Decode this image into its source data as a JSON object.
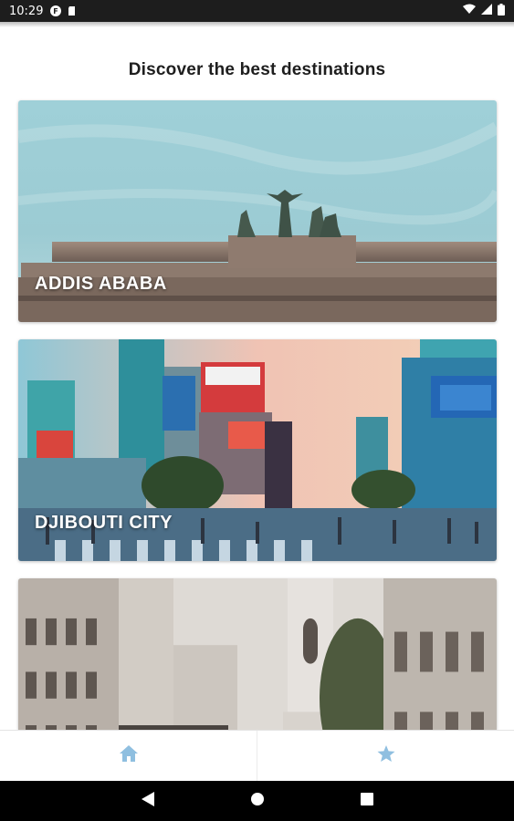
{
  "status_bar": {
    "time": "10:29",
    "icons": [
      "notification-f-icon",
      "sd-card-icon",
      "wifi-icon",
      "signal-icon",
      "battery-icon"
    ]
  },
  "page": {
    "title": "Discover the best destinations"
  },
  "destinations": [
    {
      "name": "ADDIS ABABA",
      "image": "landmark-gate-with-statues"
    },
    {
      "name": "DJIBOUTI CITY",
      "image": "busy-city-crossing-billboards"
    },
    {
      "name": "",
      "image": "historic-buildings-street"
    }
  ],
  "bottom_nav": {
    "items": [
      {
        "icon": "home-icon"
      },
      {
        "icon": "star-icon"
      }
    ],
    "icon_color": "#8fbfe0"
  },
  "system_nav": {
    "buttons": [
      "back-icon",
      "home-circle-icon",
      "recents-square-icon"
    ]
  }
}
